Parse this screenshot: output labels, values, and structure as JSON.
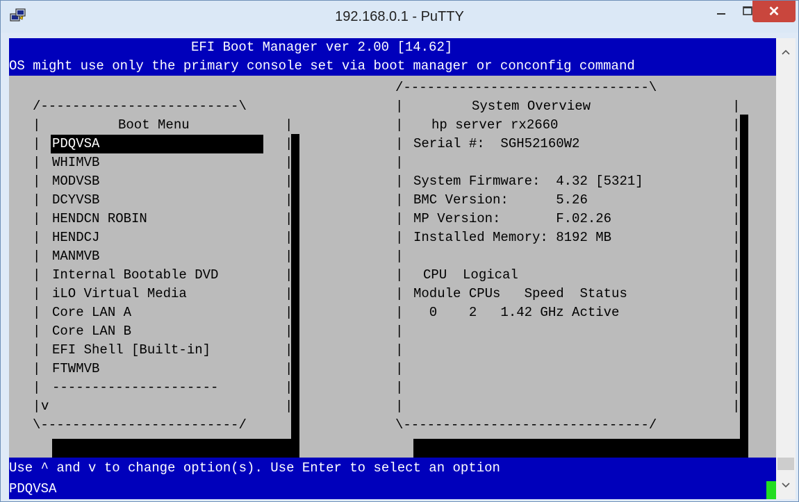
{
  "window": {
    "title": "192.168.0.1 - PuTTY",
    "close_label": "✕"
  },
  "terminal": {
    "header_line1": "EFI Boot Manager ver 2.00 [14.62]",
    "header_line2": "OS might use only the primary console set via boot manager or conconfig command",
    "boot_menu": {
      "top_border": "/-------------------------\\",
      "title": "Boot Menu",
      "items": [
        "PDQVSA",
        "WHIMVB",
        "MODVSB",
        "DCYVSB",
        "HENDCN ROBIN",
        "HENDCJ",
        "MANMVB",
        "Internal Bootable DVD",
        "iLO Virtual Media",
        "Core LAN A",
        "Core LAN B",
        "EFI Shell [Built-in]",
        "FTWMVB"
      ],
      "separator": "---------------------",
      "more_indicator": "v",
      "bottom_border": "\\-------------------------/"
    },
    "overview": {
      "top_border": "/-------------------------------\\",
      "title": "System Overview",
      "server": "hp server rx2660",
      "serial": "Serial #:  SGH52160W2",
      "firmware": "System Firmware:  4.32 [5321]",
      "bmc": "BMC Version:      5.26",
      "mp": "MP Version:       F.02.26",
      "memory": "Installed Memory: 8192 MB",
      "cpu_head1": "CPU  Logical",
      "cpu_head2": "Module CPUs   Speed  Status",
      "cpu_row": "  0    2   1.42 GHz Active",
      "bottom_border": "\\-------------------------------/"
    },
    "footer_line1": "Use ^ and v to change option(s). Use Enter to select an option",
    "footer_line2": "PDQVSA"
  },
  "icons": {
    "app": "putty-icon",
    "minimize": "minimize-icon",
    "maximize": "maximize-icon",
    "close": "close-icon",
    "scroll_up": "chevron-up-icon",
    "scroll_down": "chevron-down-icon"
  },
  "colors": {
    "term_blue": "#0000bb",
    "term_grey": "#bbbbbb",
    "close_red": "#c9463d",
    "cursor_green": "#22dd22"
  }
}
